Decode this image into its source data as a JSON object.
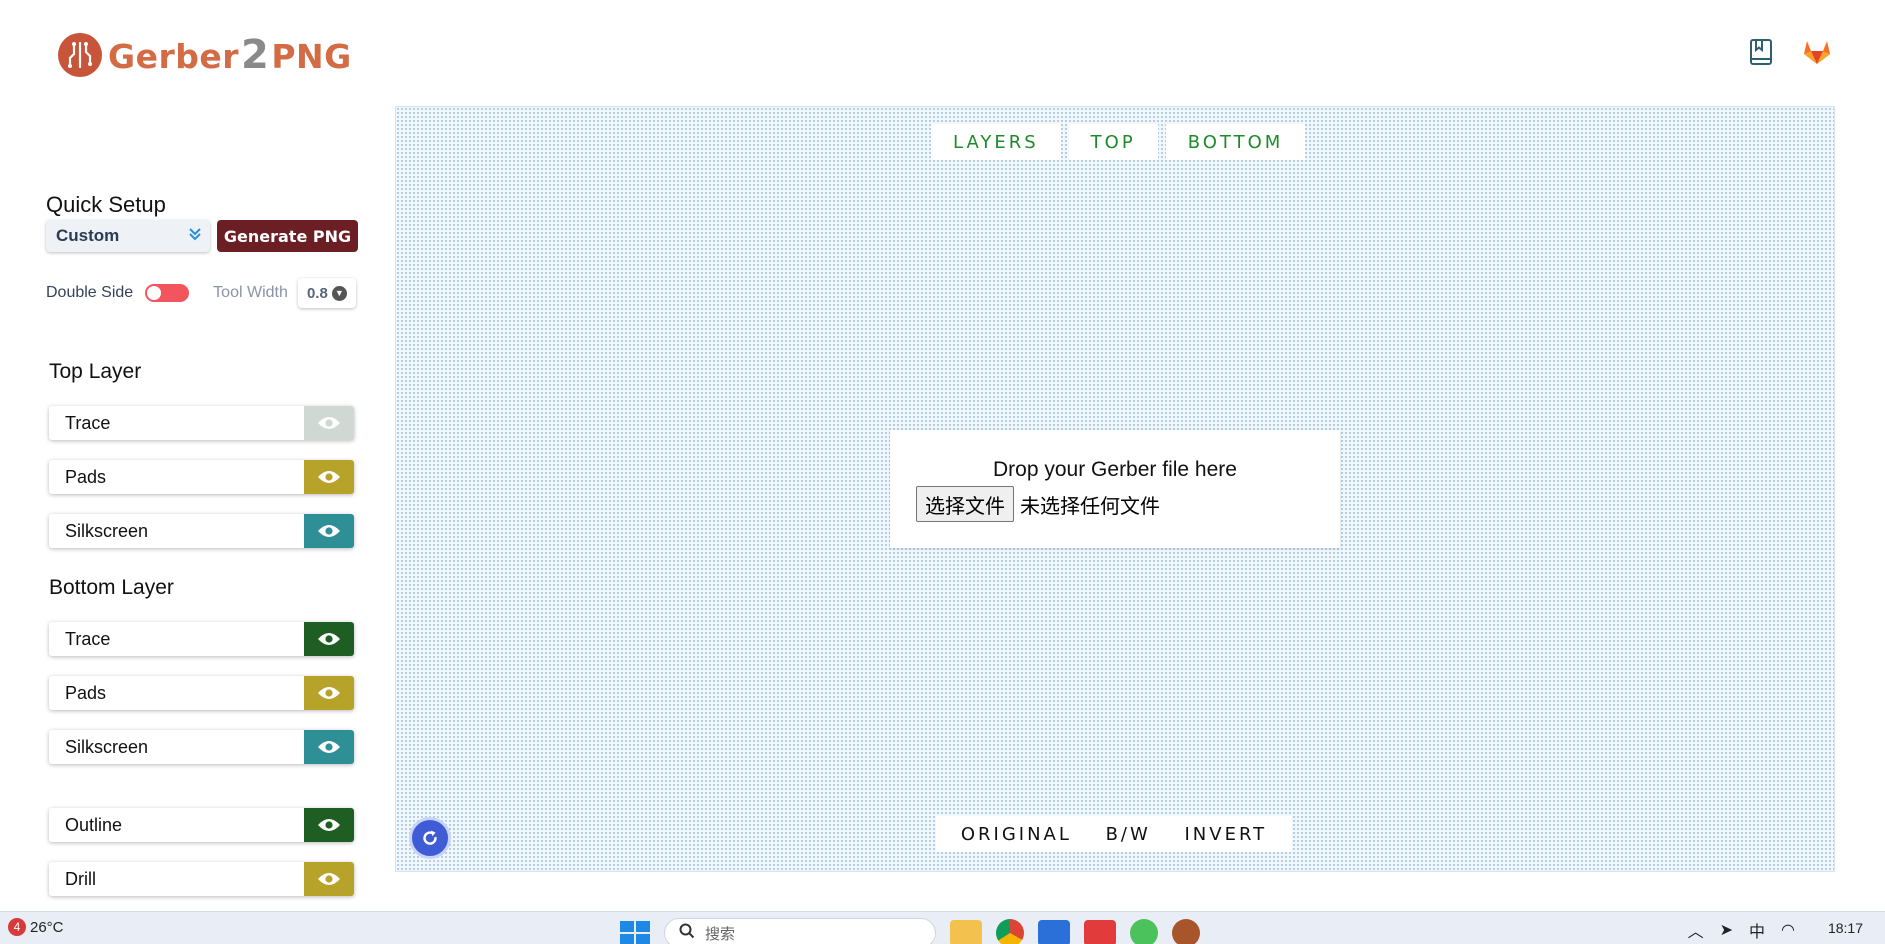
{
  "header": {
    "logo_left": "Gerber",
    "logo_two": "2",
    "logo_right": "PNG",
    "icons": [
      "book-icon",
      "gitlab-icon"
    ]
  },
  "quick_setup": {
    "title": "Quick Setup",
    "preset": "Custom",
    "generate_label": "Generate PNG",
    "double_side_label": "Double Side",
    "double_side_on": false,
    "tool_width_label": "Tool Width",
    "tool_width_value": "0.8"
  },
  "top_layer": {
    "title": "Top Layer",
    "items": [
      {
        "label": "Trace",
        "eye_color": "#cfd8d2",
        "visible": false
      },
      {
        "label": "Pads",
        "eye_color": "#b7a32a",
        "visible": true
      },
      {
        "label": "Silkscreen",
        "eye_color": "#2f8f96",
        "visible": true
      }
    ]
  },
  "bottom_layer": {
    "title": "Bottom Layer",
    "items": [
      {
        "label": "Trace",
        "eye_color": "#1e5e22",
        "visible": true
      },
      {
        "label": "Pads",
        "eye_color": "#b7a32a",
        "visible": true
      },
      {
        "label": "Silkscreen",
        "eye_color": "#2f8f96",
        "visible": true
      }
    ]
  },
  "other_layers": {
    "items": [
      {
        "label": "Outline",
        "eye_color": "#1e5e22",
        "visible": true
      },
      {
        "label": "Drill",
        "eye_color": "#b7a32a",
        "visible": true
      }
    ]
  },
  "view_tabs": [
    "LAYERS",
    "TOP",
    "BOTTOM"
  ],
  "drop_zone": {
    "title": "Drop your Gerber file here",
    "file_button": "选择文件",
    "file_status": "未选择任何文件"
  },
  "color_tabs": [
    "ORIGINAL",
    "B/W",
    "INVERT"
  ],
  "taskbar": {
    "weather_badge": "4",
    "temperature": "26°C",
    "search_placeholder": "搜索",
    "tray_ime": "中",
    "time": "18:17"
  }
}
